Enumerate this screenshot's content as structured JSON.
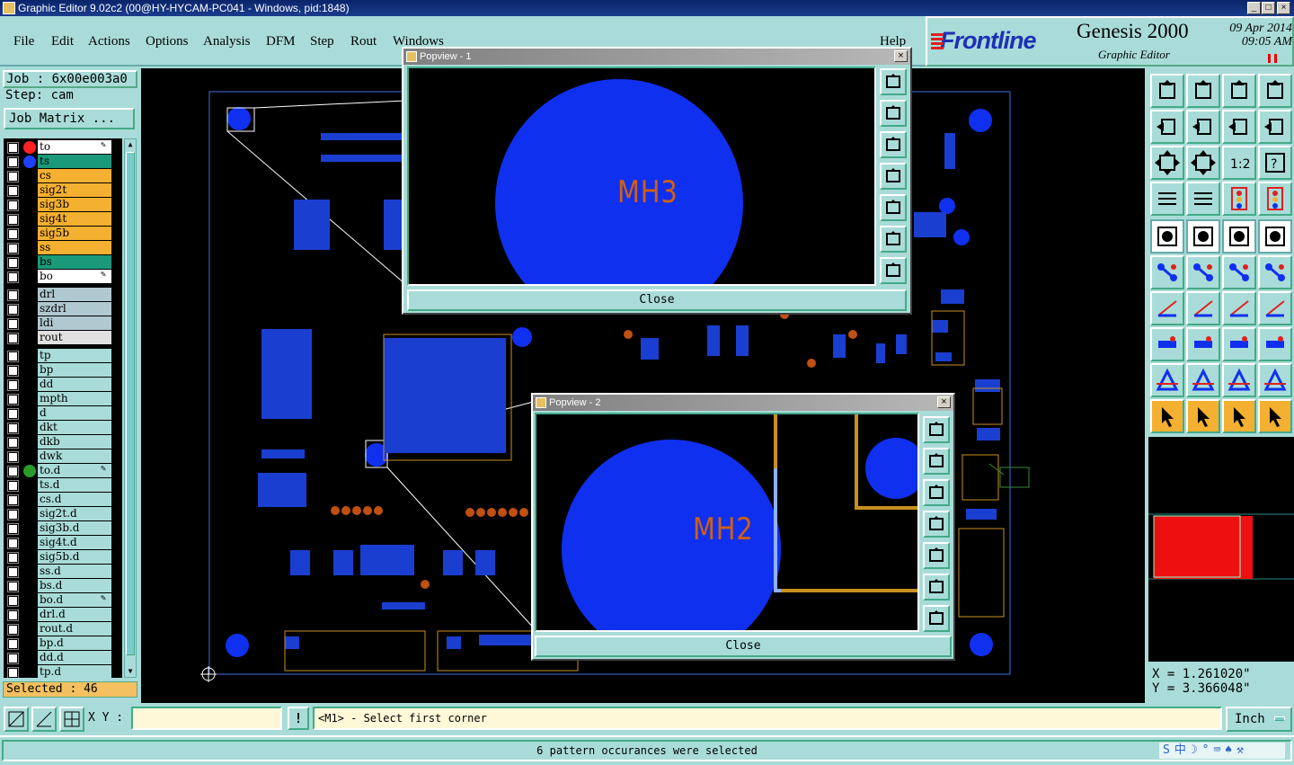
{
  "window": {
    "title": "Graphic Editor 9.02c2 (00@HY-HYCAM-PC041 - Windows, pid:1848)"
  },
  "menu": [
    "File",
    "Edit",
    "Actions",
    "Options",
    "Analysis",
    "DFM",
    "Step",
    "Rout",
    "Windows",
    "Help"
  ],
  "brand": {
    "logo": "Frontline",
    "product": "Genesis 2000",
    "subtitle": "Graphic Editor",
    "date": "09 Apr 2014",
    "time": "09:05 AM"
  },
  "job": {
    "label": "Job : 6x00e003a0",
    "step": "Step: cam",
    "matrix_button": "Job Matrix ..."
  },
  "layers": [
    {
      "name": "to",
      "bg": "#ffffff",
      "dot": "#ff2020",
      "mark": "✎"
    },
    {
      "name": "ts",
      "bg": "#1a9a7a",
      "dot": "#2040ff",
      "mark": ""
    },
    {
      "name": "cs",
      "bg": "#f4b030",
      "dot": "",
      "mark": ""
    },
    {
      "name": "sig2t",
      "bg": "#f4b030",
      "dot": "",
      "mark": ""
    },
    {
      "name": "sig3b",
      "bg": "#f4b030",
      "dot": "",
      "mark": ""
    },
    {
      "name": "sig4t",
      "bg": "#f4b030",
      "dot": "",
      "mark": ""
    },
    {
      "name": "sig5b",
      "bg": "#f4b030",
      "dot": "",
      "mark": ""
    },
    {
      "name": "ss",
      "bg": "#f4b030",
      "dot": "",
      "mark": ""
    },
    {
      "name": "bs",
      "bg": "#1a9a7a",
      "dot": "",
      "mark": ""
    },
    {
      "name": "bo",
      "bg": "#ffffff",
      "dot": "",
      "mark": "✎"
    },
    {
      "name": "drl",
      "bg": "#b0c8d0",
      "dot": "",
      "mark": "",
      "gap": true
    },
    {
      "name": "szdrl",
      "bg": "#b0c8d0",
      "dot": "",
      "mark": ""
    },
    {
      "name": "ldi",
      "bg": "#b0c8d0",
      "dot": "",
      "mark": ""
    },
    {
      "name": "rout",
      "bg": "#e0e0e0",
      "dot": "",
      "mark": ""
    },
    {
      "name": "tp",
      "bg": "#a9dcd8",
      "dot": "",
      "mark": "",
      "gap": true
    },
    {
      "name": "bp",
      "bg": "#a9dcd8",
      "dot": "",
      "mark": ""
    },
    {
      "name": "dd",
      "bg": "#a9dcd8",
      "dot": "",
      "mark": ""
    },
    {
      "name": "mpth",
      "bg": "#a9dcd8",
      "dot": "",
      "mark": ""
    },
    {
      "name": "d",
      "bg": "#a9dcd8",
      "dot": "",
      "mark": ""
    },
    {
      "name": "dkt",
      "bg": "#a9dcd8",
      "dot": "",
      "mark": ""
    },
    {
      "name": "dkb",
      "bg": "#a9dcd8",
      "dot": "",
      "mark": ""
    },
    {
      "name": "dwk",
      "bg": "#a9dcd8",
      "dot": "",
      "mark": ""
    },
    {
      "name": "to.d",
      "bg": "#a9dcd8",
      "dot": "#2a9a2a",
      "mark": "✎ ⊞"
    },
    {
      "name": "ts.d",
      "bg": "#a9dcd8",
      "dot": "",
      "mark": ""
    },
    {
      "name": "cs.d",
      "bg": "#a9dcd8",
      "dot": "",
      "mark": ""
    },
    {
      "name": "sig2t.d",
      "bg": "#a9dcd8",
      "dot": "",
      "mark": ""
    },
    {
      "name": "sig3b.d",
      "bg": "#a9dcd8",
      "dot": "",
      "mark": ""
    },
    {
      "name": "sig4t.d",
      "bg": "#a9dcd8",
      "dot": "",
      "mark": ""
    },
    {
      "name": "sig5b.d",
      "bg": "#a9dcd8",
      "dot": "",
      "mark": ""
    },
    {
      "name": "ss.d",
      "bg": "#a9dcd8",
      "dot": "",
      "mark": ""
    },
    {
      "name": "bs.d",
      "bg": "#a9dcd8",
      "dot": "",
      "mark": ""
    },
    {
      "name": "bo.d",
      "bg": "#a9dcd8",
      "dot": "",
      "mark": "✎"
    },
    {
      "name": "drl.d",
      "bg": "#a9dcd8",
      "dot": "",
      "mark": ""
    },
    {
      "name": "rout.d",
      "bg": "#a9dcd8",
      "dot": "",
      "mark": ""
    },
    {
      "name": "bp.d",
      "bg": "#a9dcd8",
      "dot": "",
      "mark": ""
    },
    {
      "name": "dd.d",
      "bg": "#a9dcd8",
      "dot": "",
      "mark": ""
    },
    {
      "name": "tp.d",
      "bg": "#a9dcd8",
      "dot": "",
      "mark": ""
    }
  ],
  "selected": "Selected : 46",
  "popup1": {
    "title": "Popview - 1",
    "label": "MH3",
    "close": "Close"
  },
  "popup2": {
    "title": "Popview - 2",
    "label": "MH2",
    "close": "Close"
  },
  "coords": {
    "x": "X = 1.261020\"",
    "y": "Y = 3.366048\""
  },
  "bottom": {
    "xy_label": "X Y :",
    "xy_value": "",
    "prompt": "<M1> - Select first corner",
    "unit": "Inch"
  },
  "status": "6 pattern occurances were selected",
  "tray": "S中☽°⌨♠⚒",
  "colors": {
    "panel": "#a9dcd8",
    "copper": "#f4b030",
    "pad": "#1030f0",
    "silk": "#d06010"
  }
}
